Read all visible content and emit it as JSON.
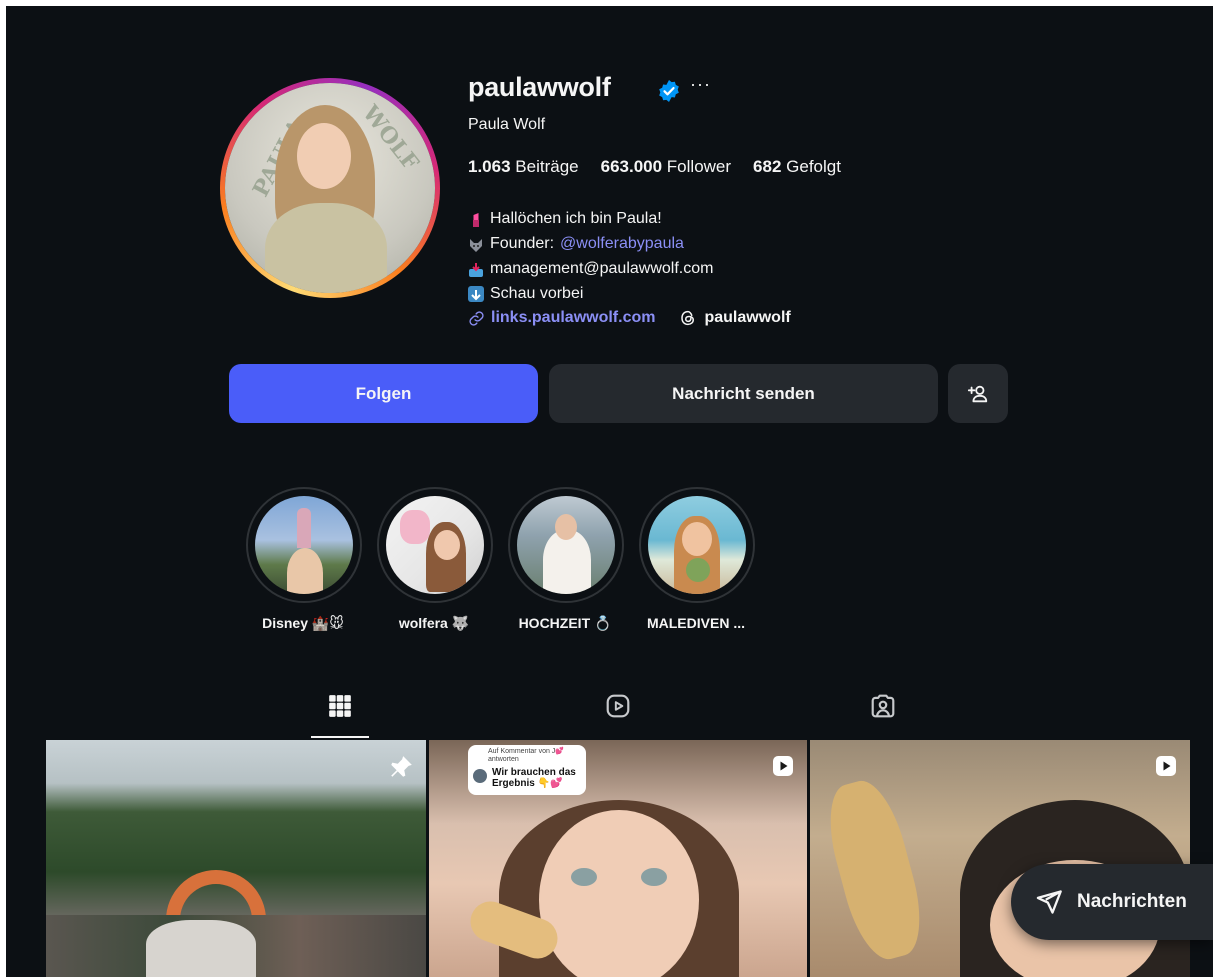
{
  "profile": {
    "username": "paulawwolf",
    "full_name": "Paula Wolf",
    "more_label": "···",
    "avatar_words": [
      "PAULA",
      "WOLF"
    ],
    "stats": {
      "posts_count": "1.063",
      "posts_label": "Beiträge",
      "followers_count": "663.000",
      "followers_label": "Follower",
      "following_count": "682",
      "following_label": "Gefolgt"
    },
    "bio": {
      "line1": "Hallöchen ich bin Paula!",
      "line2_prefix": "Founder:",
      "line2_mention": "@wolferabypaula",
      "line3": "management@paulawwolf.com",
      "line4": "Schau vorbei"
    },
    "link_url": "links.paulawwolf.com",
    "threads_handle": "paulawwolf"
  },
  "actions": {
    "follow": "Folgen",
    "message": "Nachricht senden"
  },
  "highlights": [
    {
      "label": "Disney 🏰🐭"
    },
    {
      "label": "wolfera 🐺"
    },
    {
      "label": "HOCHZEIT 💍"
    },
    {
      "label": "MALEDIVEN ..."
    }
  ],
  "tabs": [
    {
      "icon": "grid-icon",
      "active": true
    },
    {
      "icon": "reels-icon",
      "active": false
    },
    {
      "icon": "tagged-icon",
      "active": false
    }
  ],
  "posts": [
    {
      "type": "pinned",
      "icon": "pin-icon"
    },
    {
      "type": "reel",
      "icon": "reel-icon",
      "overlay_small": "Auf Kommentar von J💕 antworten",
      "overlay_text": "Wir brauchen das Ergebnis 👇💕"
    },
    {
      "type": "reel",
      "icon": "reel-icon"
    }
  ],
  "messages_pill": {
    "label": "Nachrichten"
  },
  "colors": {
    "background": "#0c1014",
    "primary_button": "#4a5df9",
    "secondary_button": "#25292e",
    "link": "#8b8ff5",
    "verified": "#0095f6"
  }
}
